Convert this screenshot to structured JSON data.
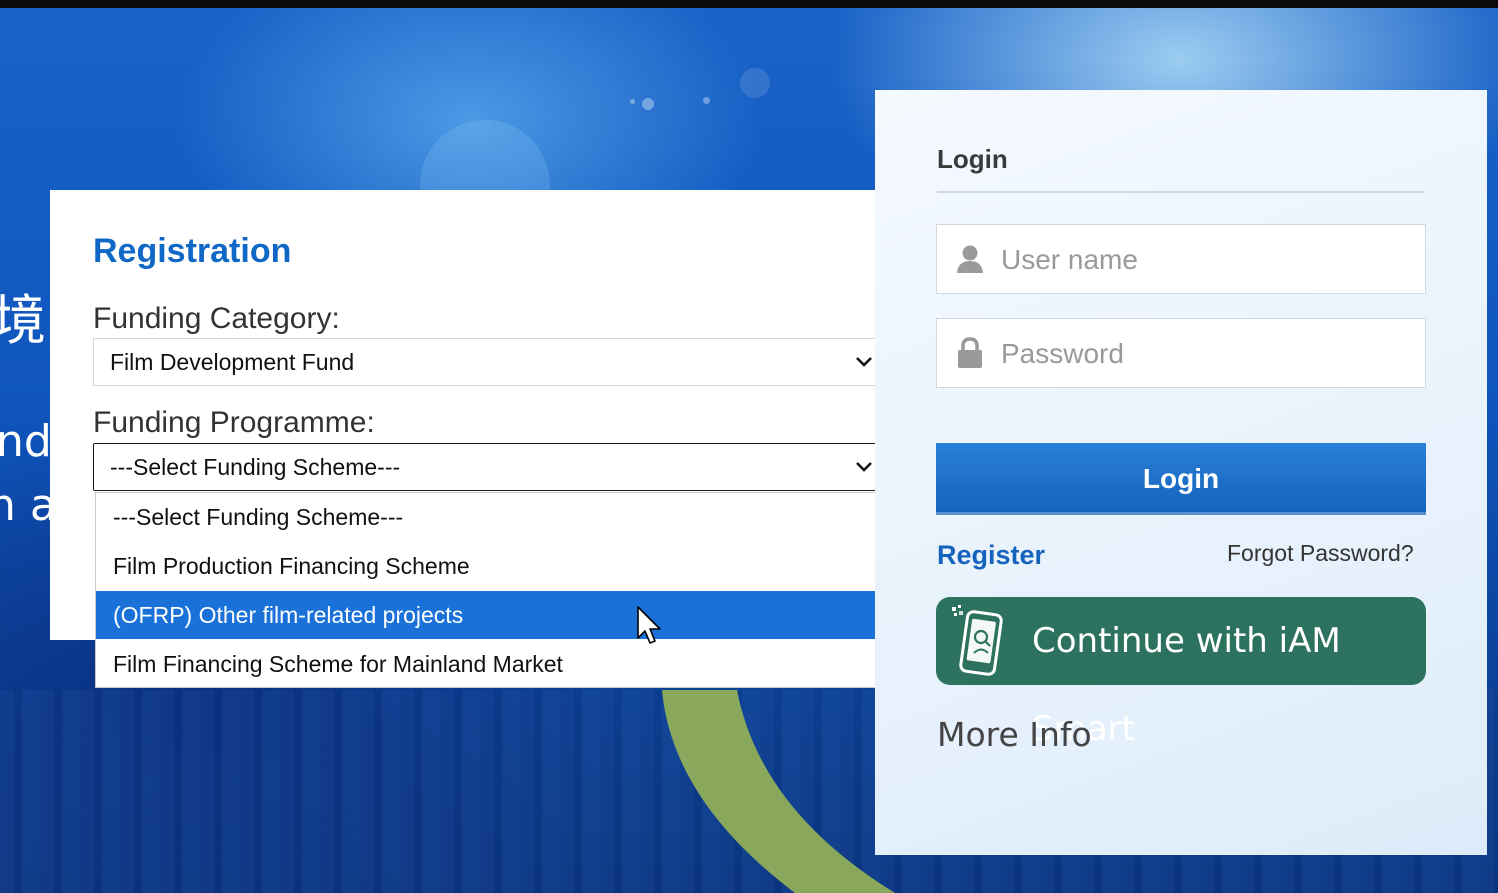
{
  "registration": {
    "title": "Registration",
    "category_label": "Funding Category:",
    "category_value": "Film Development Fund",
    "programme_label": "Funding Programme:",
    "programme_value": "---Select Funding Scheme---",
    "programme_options": [
      "---Select Funding Scheme---",
      "Film Production Financing Scheme",
      "(OFRP) Other film-related projects",
      "Film Financing Scheme for Mainland Market"
    ],
    "highlighted_option": "(OFRP) Other film-related projects"
  },
  "background_text": {
    "line1": "境",
    "line2": "nd",
    "line3": "n a"
  },
  "login": {
    "title": "Login",
    "username_placeholder": "User name",
    "password_placeholder": "Password",
    "login_button": "Login",
    "register_link": "Register",
    "forgot_link": "Forgot Password?",
    "iam_smart_button": "Continue with iAM Smart",
    "more_info": "More Info"
  },
  "colors": {
    "accent_blue": "#1563bd",
    "iam_green": "#2d725f",
    "highlight": "#1a72d9",
    "arc_green": "#8aa85c"
  },
  "icons": [
    "user-icon",
    "lock-icon",
    "chevron-down-icon",
    "iam-smart-phone-icon",
    "mouse-pointer-icon"
  ]
}
